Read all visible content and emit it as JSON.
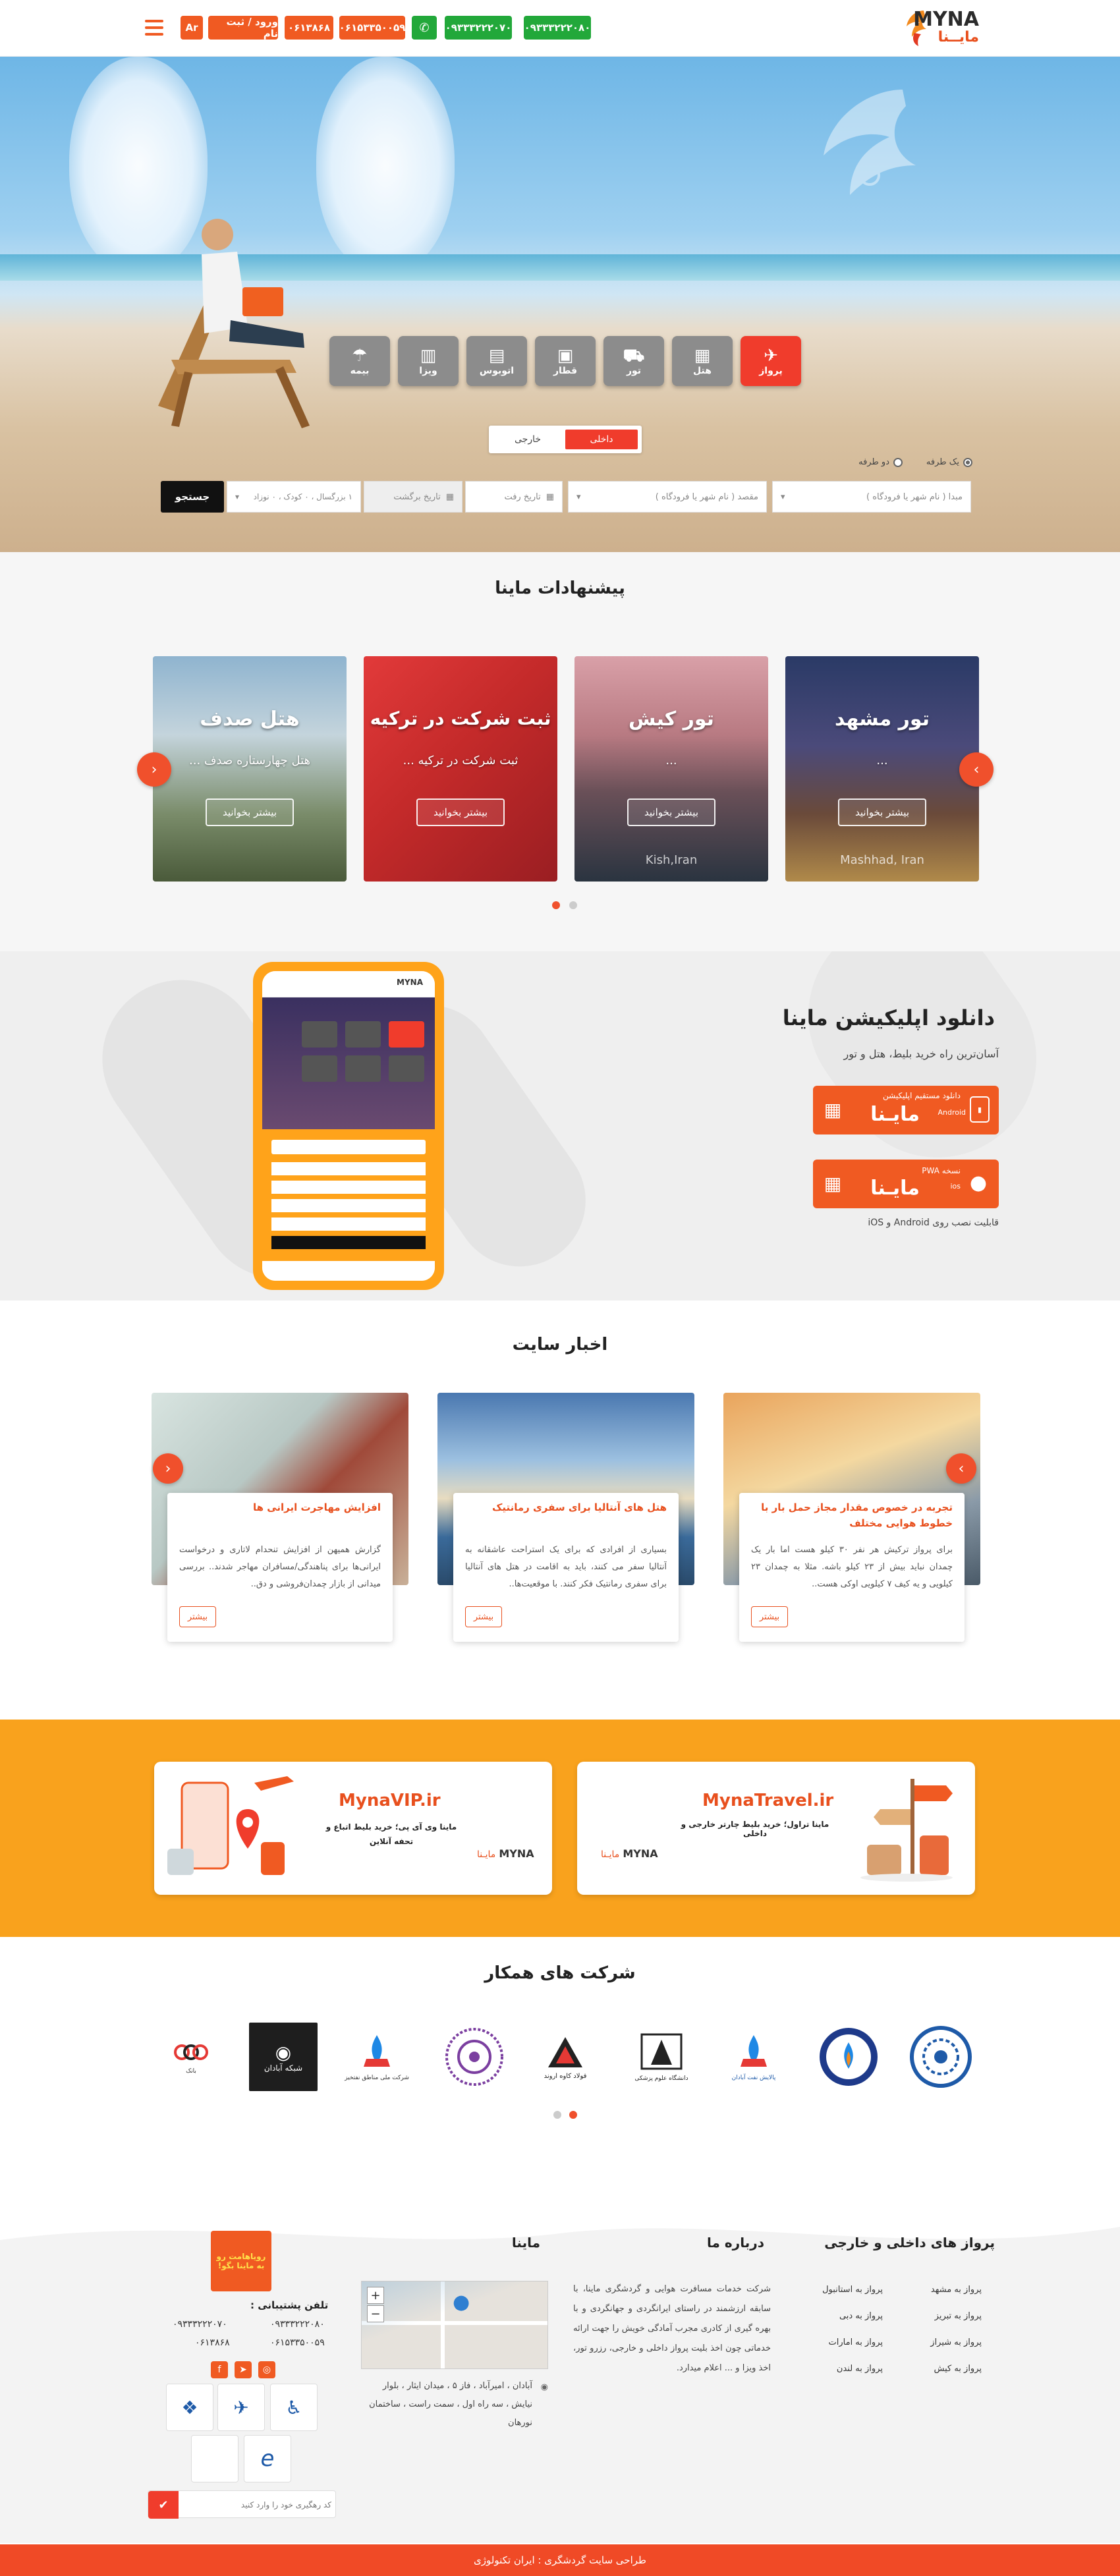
{
  "header": {
    "brand_en": "MYNA",
    "brand_fa": "مایــنا",
    "phone1": "۰۹۳۳۳۲۲۲۰۸۰",
    "phone2": "۰۹۳۳۳۲۲۲۰۷۰",
    "phone3": "۰۶۱۵۳۳۵۰۰۵۹",
    "phone4": "۰۶۱۳۸۶۸",
    "login_label": "ورود / ثبت نام",
    "lang_label": "Ar",
    "accent": "#f05a22",
    "green": "#22a83a"
  },
  "hero": {
    "services": [
      {
        "label": "پرواز",
        "icon": "airplane-icon"
      },
      {
        "label": "هتل",
        "icon": "hotel-icon"
      },
      {
        "label": "تور",
        "icon": "tour-icon"
      },
      {
        "label": "قطار",
        "icon": "train-icon"
      },
      {
        "label": "اتوبوس",
        "icon": "bus-icon"
      },
      {
        "label": "ویزا",
        "icon": "visa-icon"
      },
      {
        "label": "بیمه",
        "icon": "umbrella-icon"
      }
    ],
    "tab_domestic": "داخلی",
    "tab_foreign": "خارجی",
    "trip_oneway": "یک طرفه",
    "trip_round": "دو طرفه",
    "origin_placeholder": "مبدا ( نام شهر یا فرودگاه )",
    "destination_placeholder": "مقصد ( نام شهر یا فرودگاه )",
    "depart_placeholder": "تاریخ رفت",
    "return_placeholder": "تاریخ برگشت",
    "passengers_value": "۱ بزرگسال ، ۰ کودک ، ۰ نوزاد",
    "search_label": "جستجو"
  },
  "offers": {
    "title": "پیشنهادات ماینا",
    "cards": [
      {
        "title": "تور مشهد",
        "subtitle": "...",
        "more": "بیشتر بخوانید",
        "watermark": "Mashhad, Iran"
      },
      {
        "title": "تور کیش",
        "subtitle": "...",
        "more": "بیشتر بخوانید",
        "watermark": "Kish,Iran"
      },
      {
        "title": "ثبت شرکت در ترکیه",
        "subtitle": "ثبت شرکت در ترکیه ...",
        "more": "بیشتر بخوانید",
        "watermark": ""
      },
      {
        "title": "هتل صدف",
        "subtitle": "هتل چهارستاره صدف ...",
        "more": "بیشتر بخوانید",
        "watermark": ""
      }
    ]
  },
  "app": {
    "title": "دانلود اپلیکیشن ماینا",
    "subtitle": "آسان‌ترین راه خرید بلیط، هتل و تور",
    "android_small": "دانلود مستقیم اپلیکیشن",
    "android_os": "Android",
    "ios_small": "نسخه PWA",
    "ios_os": "ios",
    "brand_fa": "مایـنا",
    "compat": "قابلیت نصب روی Android و iOS"
  },
  "news": {
    "title": "اخبار سایت",
    "items": [
      {
        "title": "تجربه در خصوص مقدار مجاز حمل بار با خطوط هوایی مختلف",
        "body": "برای پرواز ترکیش هر نفر ۳۰ کیلو هست اما بار یک چمدان نباید بیش از ۲۳ کیلو باشه. مثلا به چمدان ۲۳ کیلویی و یه کیف ۷ کیلویی اوکی هست..",
        "more": "بیشتر"
      },
      {
        "title": "هتل های آنتالیا برای سفری رمانتیک",
        "body": "بسیاری از افرادی که برای یک استراحت عاشقانه به آنتالیا سفر می کنند، باید به اقامت در هتل های آنتالیا برای سفری رمانتیک فکر کنند. با موقعیت‌ها..",
        "more": "بیشتر"
      },
      {
        "title": "افزایش مهاجرت ایرانی ها",
        "body": "گزارش همیهن از افزایش تنحدام لاتاری و درخواست ایرانی‌ها برای پناهندگی/مسافران مهاجر شدند.. بررسی میدانی از بازار چمدان‌فروشی و دق..",
        "more": "بیشتر"
      }
    ]
  },
  "banners": {
    "travel_title": "MynaTravel.ir",
    "travel_sub": "ماینا تراول؛ خرید بلیط چارتر خارجی و داخلی",
    "vip_title": "MynaVIP.ir",
    "vip_sub": "ماینا وی آی پی؛ خرید بلیط اتباع و تحفه آنلاین",
    "brand_en": "MYNA",
    "brand_fa": "مایـنا"
  },
  "partners": {
    "title": "شرکت های همکار",
    "logos": [
      {
        "name": "مرکز",
        "label": ""
      },
      {
        "name": "نفت",
        "label": ""
      },
      {
        "name": "پالایش",
        "label": "پالایش نفت آبادان"
      },
      {
        "name": "دانشگاه",
        "label": "دانشگاه علوم پزشکی"
      },
      {
        "name": "فولاد",
        "label": "فولاد کاوه اروند"
      },
      {
        "name": "بیمارستان",
        "label": ""
      },
      {
        "name": "نفت مناطق",
        "label": "شرکت ملی مناطق نفتخیز"
      },
      {
        "name": "آبادان",
        "label": "شبکه آبادان"
      },
      {
        "name": "بانک",
        "label": "بانک"
      }
    ]
  },
  "footer": {
    "flights_title": "پرواز های داخلی و خارجی",
    "flights_right": [
      "پرواز به مشهد",
      "پرواز به تبریز",
      "پرواز به شیراز",
      "پرواز به کیش"
    ],
    "flights_left": [
      "پرواز به استانبول",
      "پرواز به دبی",
      "پرواز به امارات",
      "پرواز به لندن"
    ],
    "about_title": "درباره ما",
    "about_body": "شرکت خدمات مسافرت هوایی و گردشگری ماینا، با سابقه ارزشمند در راستای ایرانگردی و جهانگردی و با بهره گیری از کادری مجرب آمادگی خویش را جهت ارائه خدماتی چون اخذ بلیت پرواز داخلی و خارجی، رزرو تور، اخذ ویزا و ... اعلام میدارد.",
    "myna_title": "ماینا",
    "address": "آبادان ، امیرآباد ، فاز ۵ ، میدان ایثار ، بلوار نیایش ، سه راه اول ، سمت راست ، ساختمان نورهان",
    "support_label": "تلفن پشتیبانی :",
    "support_phones": [
      "۰۹۳۳۳۲۲۲۰۸۰",
      "۰۹۳۳۳۲۲۲۰۷۰",
      "۰۶۱۵۳۳۵۰۰۵۹",
      "۰۶۱۳۸۶۸"
    ],
    "promo": "رویاهامت رو به ماینا بگو!",
    "tracking_placeholder": "کد رهگیری خود را وارد کنید",
    "credit": "طراحی سایت گردشگری : ایران تکنولوژی"
  }
}
